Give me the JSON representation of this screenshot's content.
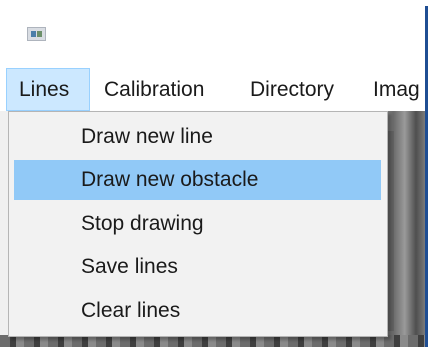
{
  "window": {
    "icon": "app-window-icon"
  },
  "menubar": {
    "items": [
      {
        "label": "Lines",
        "active": true
      },
      {
        "label": "Calibration"
      },
      {
        "label": "Directory"
      },
      {
        "label": "Imag"
      }
    ]
  },
  "dropdown": {
    "items": [
      {
        "label": "Draw new line"
      },
      {
        "label": "Draw new obstacle",
        "highlighted": true
      },
      {
        "label": "Stop drawing"
      },
      {
        "label": "Save lines"
      },
      {
        "label": "Clear lines"
      }
    ]
  },
  "colors": {
    "menu_active_bg": "#cce8ff",
    "menu_active_border": "#99d1ff",
    "dropdown_highlight": "#91c9f7",
    "dropdown_bg": "#f2f2f2",
    "window_frame": "#1f4e93"
  }
}
